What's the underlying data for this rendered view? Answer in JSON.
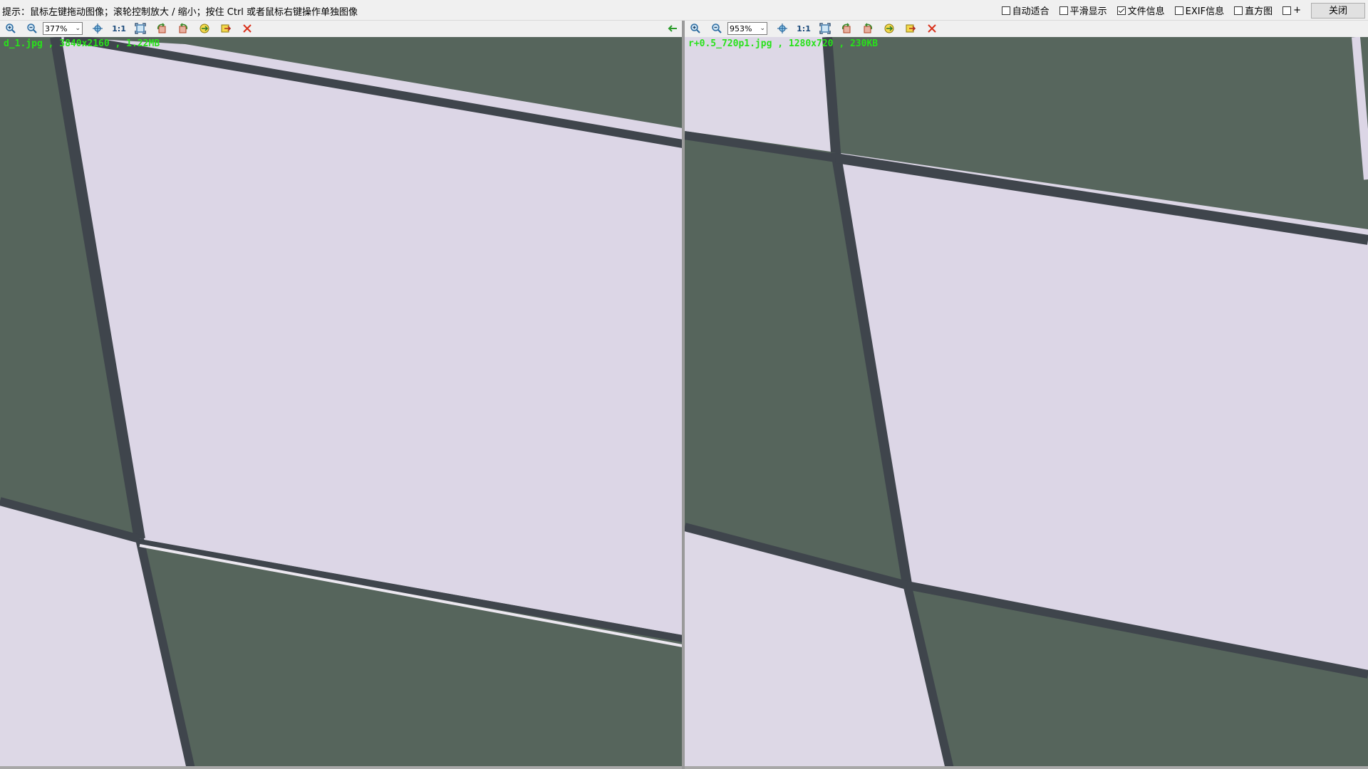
{
  "hint": "提示：鼠标左键拖动图像；滚轮控制放大 / 缩小；按住 Ctrl 或者鼠标右键操作单独图像",
  "options": [
    {
      "label": "自动适合",
      "checked": false
    },
    {
      "label": "平滑显示",
      "checked": false
    },
    {
      "label": "文件信息",
      "checked": true
    },
    {
      "label": "EXIF信息",
      "checked": false
    },
    {
      "label": "直方图",
      "checked": false
    },
    {
      "label": "+",
      "checked": false
    }
  ],
  "close_label": "关闭",
  "left": {
    "zoom": "377%",
    "one_to_one": "1:1",
    "file_info": "d_1.jpg , 3840x2160 , 1.22MB"
  },
  "right": {
    "zoom": "953%",
    "one_to_one": "1:1",
    "file_info": "r+0.5_720p1.jpg , 1280x720 , 230KB"
  },
  "colors": {
    "tile_light": "#dcd6e6",
    "tile_dark": "#55645c",
    "grout": "#3d444a",
    "file_info_text": "#28e21a"
  }
}
